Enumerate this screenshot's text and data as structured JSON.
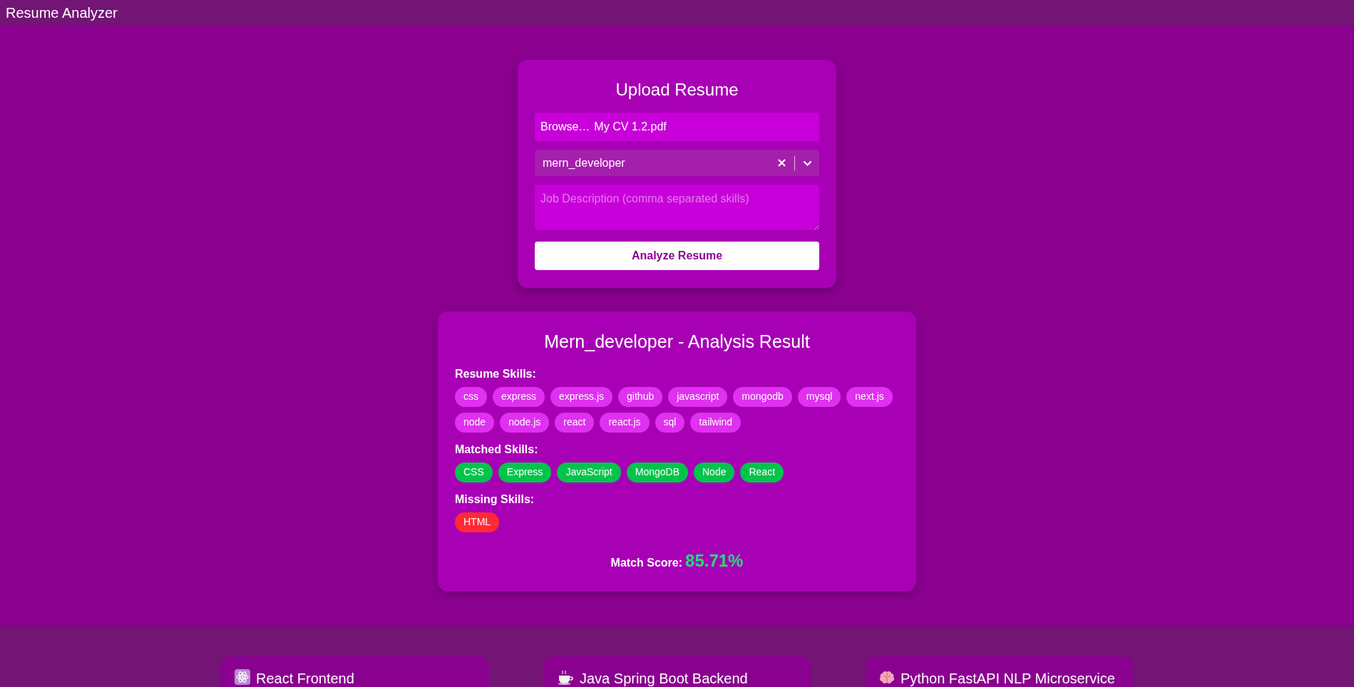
{
  "header": {
    "title": "Resume Analyzer"
  },
  "upload": {
    "title": "Upload Resume",
    "file_input": {
      "button": "Browse…",
      "file_name": "My CV 1.2.pdf"
    },
    "role_select": {
      "value": "mern_developer"
    },
    "job_description": {
      "placeholder": "Job Description (comma separated skills)"
    },
    "submit": "Analyze Resume"
  },
  "result": {
    "title": "Mern_developer - Analysis Result",
    "sections": [
      {
        "label": "Resume Skills:",
        "kind": "resume",
        "skills": [
          "css",
          "express",
          "express.js",
          "github",
          "javascript",
          "mongodb",
          "mysql",
          "next.js",
          "node",
          "node.js",
          "react",
          "react.js",
          "sql",
          "tailwind"
        ]
      },
      {
        "label": "Matched Skills:",
        "kind": "matched",
        "skills": [
          "CSS",
          "Express",
          "JavaScript",
          "MongoDB",
          "Node",
          "React"
        ]
      },
      {
        "label": "Missing Skills:",
        "kind": "missing",
        "skills": [
          "HTML"
        ]
      }
    ],
    "score_label": "Match Score:",
    "score": "85.71%"
  },
  "footer_cards": [
    {
      "kind": "atom",
      "title": "React Frontend"
    },
    {
      "kind": "cup",
      "title": "Java Spring Boot Backend"
    },
    {
      "kind": "brain",
      "title": "Python FastAPI NLP Microservice"
    }
  ]
}
